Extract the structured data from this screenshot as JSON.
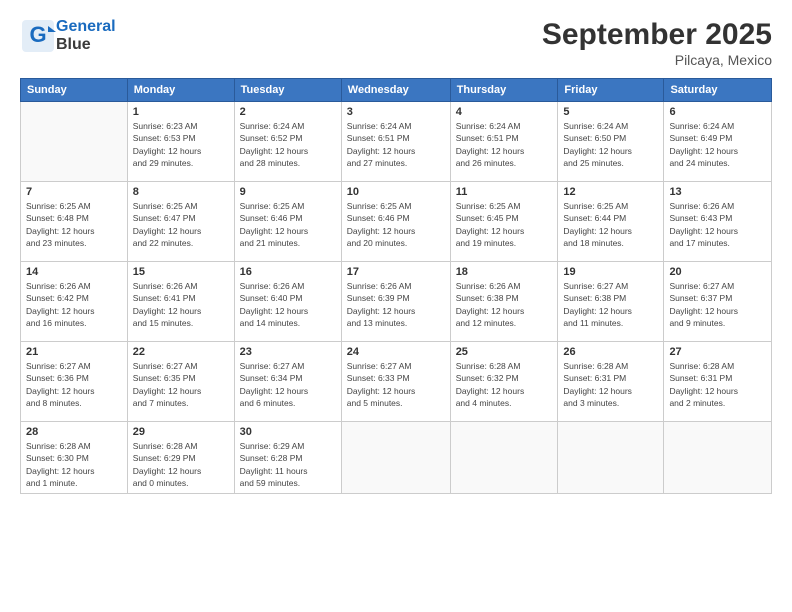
{
  "header": {
    "logo_line1": "General",
    "logo_line2": "Blue",
    "month": "September 2025",
    "location": "Pilcaya, Mexico"
  },
  "weekdays": [
    "Sunday",
    "Monday",
    "Tuesday",
    "Wednesday",
    "Thursday",
    "Friday",
    "Saturday"
  ],
  "weeks": [
    [
      {
        "day": "",
        "info": ""
      },
      {
        "day": "1",
        "info": "Sunrise: 6:23 AM\nSunset: 6:53 PM\nDaylight: 12 hours\nand 29 minutes."
      },
      {
        "day": "2",
        "info": "Sunrise: 6:24 AM\nSunset: 6:52 PM\nDaylight: 12 hours\nand 28 minutes."
      },
      {
        "day": "3",
        "info": "Sunrise: 6:24 AM\nSunset: 6:51 PM\nDaylight: 12 hours\nand 27 minutes."
      },
      {
        "day": "4",
        "info": "Sunrise: 6:24 AM\nSunset: 6:51 PM\nDaylight: 12 hours\nand 26 minutes."
      },
      {
        "day": "5",
        "info": "Sunrise: 6:24 AM\nSunset: 6:50 PM\nDaylight: 12 hours\nand 25 minutes."
      },
      {
        "day": "6",
        "info": "Sunrise: 6:24 AM\nSunset: 6:49 PM\nDaylight: 12 hours\nand 24 minutes."
      }
    ],
    [
      {
        "day": "7",
        "info": "Sunrise: 6:25 AM\nSunset: 6:48 PM\nDaylight: 12 hours\nand 23 minutes."
      },
      {
        "day": "8",
        "info": "Sunrise: 6:25 AM\nSunset: 6:47 PM\nDaylight: 12 hours\nand 22 minutes."
      },
      {
        "day": "9",
        "info": "Sunrise: 6:25 AM\nSunset: 6:46 PM\nDaylight: 12 hours\nand 21 minutes."
      },
      {
        "day": "10",
        "info": "Sunrise: 6:25 AM\nSunset: 6:46 PM\nDaylight: 12 hours\nand 20 minutes."
      },
      {
        "day": "11",
        "info": "Sunrise: 6:25 AM\nSunset: 6:45 PM\nDaylight: 12 hours\nand 19 minutes."
      },
      {
        "day": "12",
        "info": "Sunrise: 6:25 AM\nSunset: 6:44 PM\nDaylight: 12 hours\nand 18 minutes."
      },
      {
        "day": "13",
        "info": "Sunrise: 6:26 AM\nSunset: 6:43 PM\nDaylight: 12 hours\nand 17 minutes."
      }
    ],
    [
      {
        "day": "14",
        "info": "Sunrise: 6:26 AM\nSunset: 6:42 PM\nDaylight: 12 hours\nand 16 minutes."
      },
      {
        "day": "15",
        "info": "Sunrise: 6:26 AM\nSunset: 6:41 PM\nDaylight: 12 hours\nand 15 minutes."
      },
      {
        "day": "16",
        "info": "Sunrise: 6:26 AM\nSunset: 6:40 PM\nDaylight: 12 hours\nand 14 minutes."
      },
      {
        "day": "17",
        "info": "Sunrise: 6:26 AM\nSunset: 6:39 PM\nDaylight: 12 hours\nand 13 minutes."
      },
      {
        "day": "18",
        "info": "Sunrise: 6:26 AM\nSunset: 6:38 PM\nDaylight: 12 hours\nand 12 minutes."
      },
      {
        "day": "19",
        "info": "Sunrise: 6:27 AM\nSunset: 6:38 PM\nDaylight: 12 hours\nand 11 minutes."
      },
      {
        "day": "20",
        "info": "Sunrise: 6:27 AM\nSunset: 6:37 PM\nDaylight: 12 hours\nand 9 minutes."
      }
    ],
    [
      {
        "day": "21",
        "info": "Sunrise: 6:27 AM\nSunset: 6:36 PM\nDaylight: 12 hours\nand 8 minutes."
      },
      {
        "day": "22",
        "info": "Sunrise: 6:27 AM\nSunset: 6:35 PM\nDaylight: 12 hours\nand 7 minutes."
      },
      {
        "day": "23",
        "info": "Sunrise: 6:27 AM\nSunset: 6:34 PM\nDaylight: 12 hours\nand 6 minutes."
      },
      {
        "day": "24",
        "info": "Sunrise: 6:27 AM\nSunset: 6:33 PM\nDaylight: 12 hours\nand 5 minutes."
      },
      {
        "day": "25",
        "info": "Sunrise: 6:28 AM\nSunset: 6:32 PM\nDaylight: 12 hours\nand 4 minutes."
      },
      {
        "day": "26",
        "info": "Sunrise: 6:28 AM\nSunset: 6:31 PM\nDaylight: 12 hours\nand 3 minutes."
      },
      {
        "day": "27",
        "info": "Sunrise: 6:28 AM\nSunset: 6:31 PM\nDaylight: 12 hours\nand 2 minutes."
      }
    ],
    [
      {
        "day": "28",
        "info": "Sunrise: 6:28 AM\nSunset: 6:30 PM\nDaylight: 12 hours\nand 1 minute."
      },
      {
        "day": "29",
        "info": "Sunrise: 6:28 AM\nSunset: 6:29 PM\nDaylight: 12 hours\nand 0 minutes."
      },
      {
        "day": "30",
        "info": "Sunrise: 6:29 AM\nSunset: 6:28 PM\nDaylight: 11 hours\nand 59 minutes."
      },
      {
        "day": "",
        "info": ""
      },
      {
        "day": "",
        "info": ""
      },
      {
        "day": "",
        "info": ""
      },
      {
        "day": "",
        "info": ""
      }
    ]
  ]
}
